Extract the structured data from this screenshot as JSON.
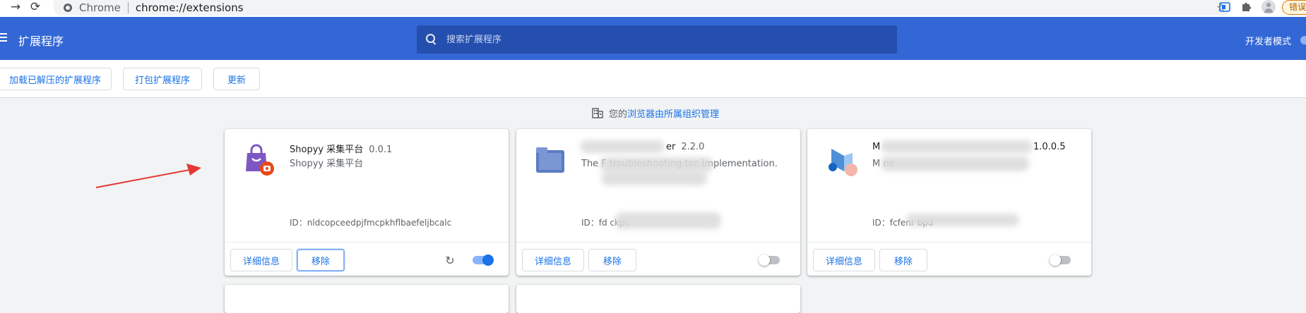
{
  "browser": {
    "origin": "Chrome",
    "url": "chrome://extensions",
    "error_chip": "错误"
  },
  "header": {
    "title": "扩展程序",
    "search_placeholder": "搜索扩展程序",
    "dev_mode_label": "开发者模式",
    "dev_mode_on": true
  },
  "toolbar": {
    "load_unpacked": "加载已解压的扩展程序",
    "pack": "打包扩展程序",
    "update": "更新"
  },
  "managed": {
    "prefix": "您的",
    "link": "浏览器由所属组织管理"
  },
  "extensions": [
    {
      "name": "Shopyy 采集平台",
      "version": "0.0.1",
      "description": "Shopyy 采集平台",
      "id": "ID：nldcopceedpjfmcpkhflbaefeljbcalc",
      "details_label": "详细信息",
      "remove_label": "移除",
      "enabled": true
    },
    {
      "name": "er",
      "version": "2.2.0",
      "description": "The F                          troubleshooting toc                                  implementation.",
      "id": "ID：fd                                    ckpc",
      "details_label": "详细信息",
      "remove_label": "移除",
      "enabled": false
    },
    {
      "name": "M",
      "version": "1.0.0.5",
      "description": "M                                        ne",
      "id": "ID：fcfenr                          bpd",
      "details_label": "详细信息",
      "remove_label": "移除",
      "enabled": false
    }
  ],
  "colors": {
    "header_bg": "#3367d6",
    "accent": "#1a73e8",
    "arrow": "#e53935"
  }
}
